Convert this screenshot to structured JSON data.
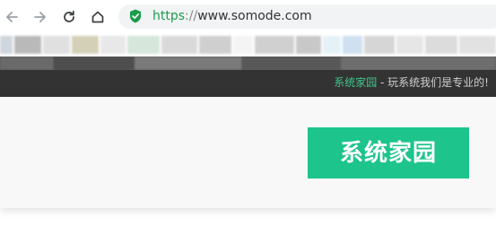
{
  "browser": {
    "url": {
      "scheme": "https",
      "separator": "://",
      "host": "www.somode.com"
    },
    "icons": {
      "back": "back-arrow-icon",
      "forward": "forward-arrow-icon",
      "reload": "reload-icon",
      "home": "home-icon",
      "security": "shield-check-icon"
    }
  },
  "site": {
    "tagline_brand": "系统家园",
    "tagline_rest": " - 玩系统我们是专业的!",
    "logo_text": "系统家园",
    "colors": {
      "brand_green": "#1dc48c",
      "dark_bar": "#333333"
    }
  }
}
